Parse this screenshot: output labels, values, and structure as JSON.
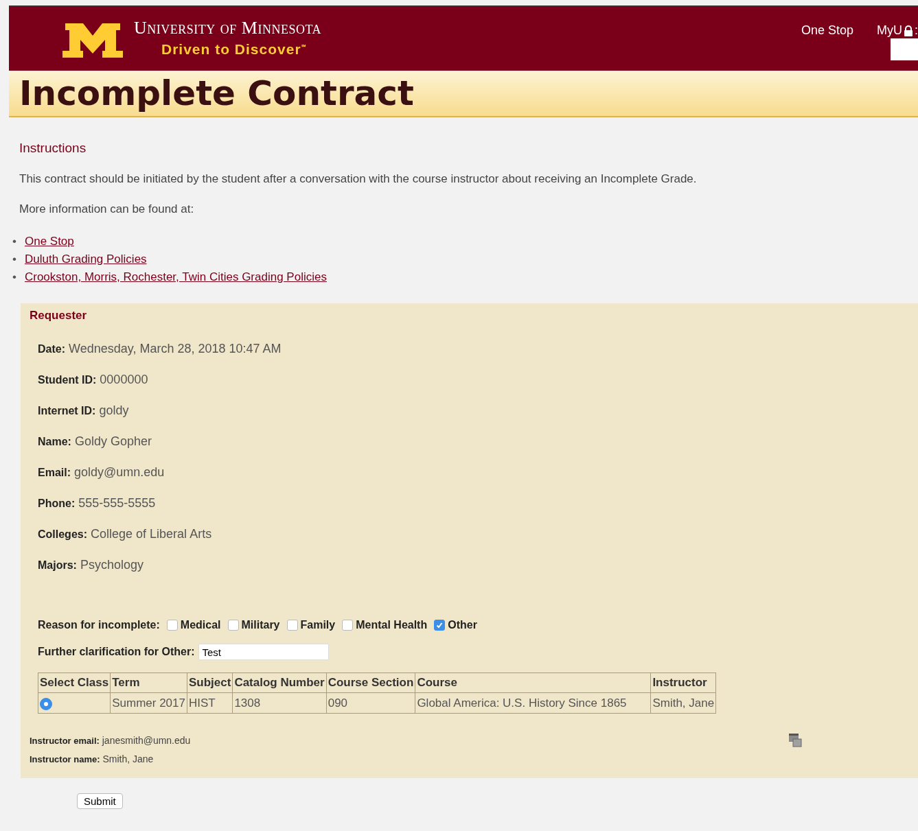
{
  "header": {
    "university": "University of Minnesota",
    "tagline": "Driven to Discover$^{℠}$",
    "nav": [
      "One Stop",
      "MyU"
    ],
    "nav_suffix": ":"
  },
  "page_title": "Incomplete Contract",
  "instructions": {
    "heading": "Instructions",
    "paragraphs": [
      "This contract should be initiated by the student after a conversation with the course instructor about receiving an Incomplete Grade.",
      "More information can be found at:"
    ],
    "links": [
      {
        "bullet": "•",
        "label": "One Stop"
      },
      {
        "bullet": "•",
        "label": "Duluth Grading Policies"
      },
      {
        "bullet": "•",
        "label": "Crookston, Morris, Rochester, Twin Cities Grading Policies"
      }
    ]
  },
  "requester": {
    "heading": "Requester",
    "fields": [
      {
        "label": "Date:",
        "value": "Wednesday, March 28, 2018 10:47 AM"
      },
      {
        "label": "Student ID:",
        "value": "0000000"
      },
      {
        "label": "Internet ID:",
        "value": "goldy"
      },
      {
        "label": "Name:",
        "value": "Goldy Gopher"
      },
      {
        "label": "Email:",
        "value": "goldy@umn.edu"
      },
      {
        "label": "Phone:",
        "value": "555-555-5555"
      },
      {
        "label": "Colleges:",
        "value": "College of Liberal Arts"
      },
      {
        "label": "Majors:",
        "value": "Psychology"
      }
    ],
    "reason_label": "Reason for incomplete:",
    "reasons": [
      {
        "label": "Medical",
        "checked": false
      },
      {
        "label": "Military",
        "checked": false
      },
      {
        "label": "Family",
        "checked": false
      },
      {
        "label": "Mental Health",
        "checked": false
      },
      {
        "label": "Other",
        "checked": true
      }
    ],
    "clarification_label": "Further clarification for Other:",
    "clarification_value": "Test",
    "table": {
      "columns": [
        "Select Class",
        "Term",
        "Subject",
        "Catalog Number",
        "Course Section",
        "Course",
        "Instructor"
      ],
      "rows": [
        {
          "selected": true,
          "cells": [
            "",
            "Summer 2017",
            "HIST",
            "1308",
            "090",
            "Global America: U.S. History Since 1865",
            "Smith, Jane"
          ]
        }
      ]
    },
    "instructor_email_label": "Instructor email:",
    "instructor_email": "janesmith@umn.edu",
    "instructor_name_label": "Instructor name:",
    "instructor_name": "Smith, Jane"
  },
  "submit": "Submit"
}
